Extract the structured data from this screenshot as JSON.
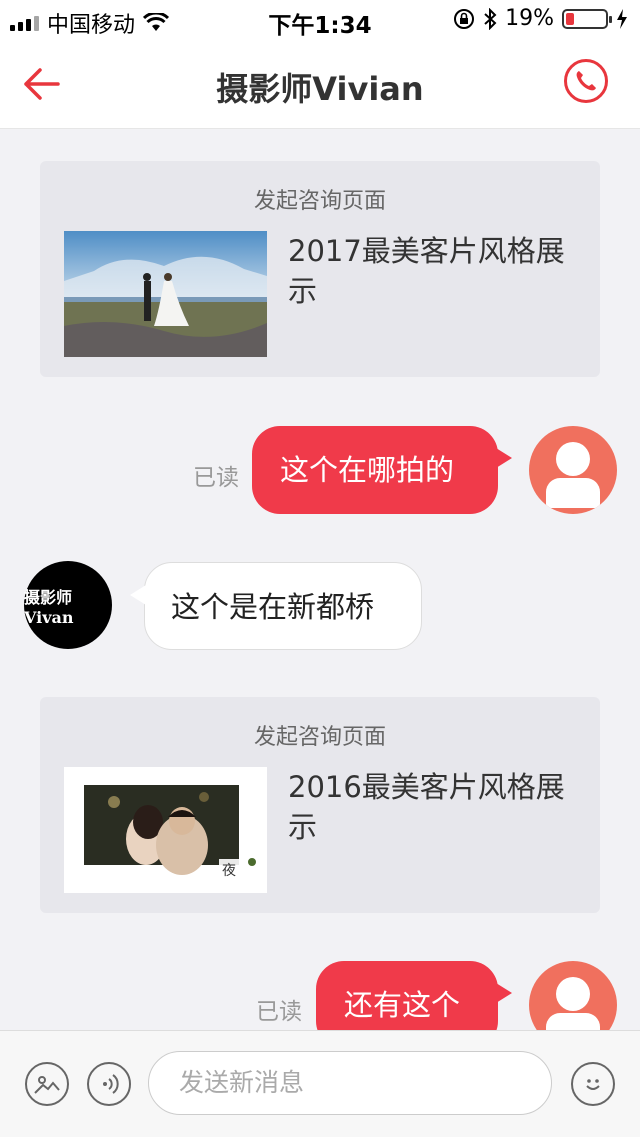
{
  "status_bar": {
    "carrier": "中国移动",
    "time": "下午1:34",
    "battery": "19%"
  },
  "nav": {
    "title": "摄影师Vivian",
    "back_icon": "back-arrow-icon",
    "call_icon": "phone-icon"
  },
  "colors": {
    "accent": "#f03a4a",
    "user_avatar": "#f0705e"
  },
  "messages": [
    {
      "type": "card",
      "title": "发起咨询页面",
      "text": "2017最美客片风格展示"
    },
    {
      "type": "sent",
      "text": "这个在哪拍的",
      "status": "已读"
    },
    {
      "type": "received",
      "text": "这个是在新都桥",
      "avatar_text": "摄影师Vivan"
    },
    {
      "type": "card",
      "title": "发起咨询页面",
      "text": "2016最美客片风格展示"
    },
    {
      "type": "sent",
      "text": "还有这个",
      "status": "已读"
    }
  ],
  "input_bar": {
    "placeholder": "发送新消息",
    "image_icon": "image-icon",
    "voice_icon": "voice-icon",
    "emoji_icon": "emoji-icon"
  }
}
